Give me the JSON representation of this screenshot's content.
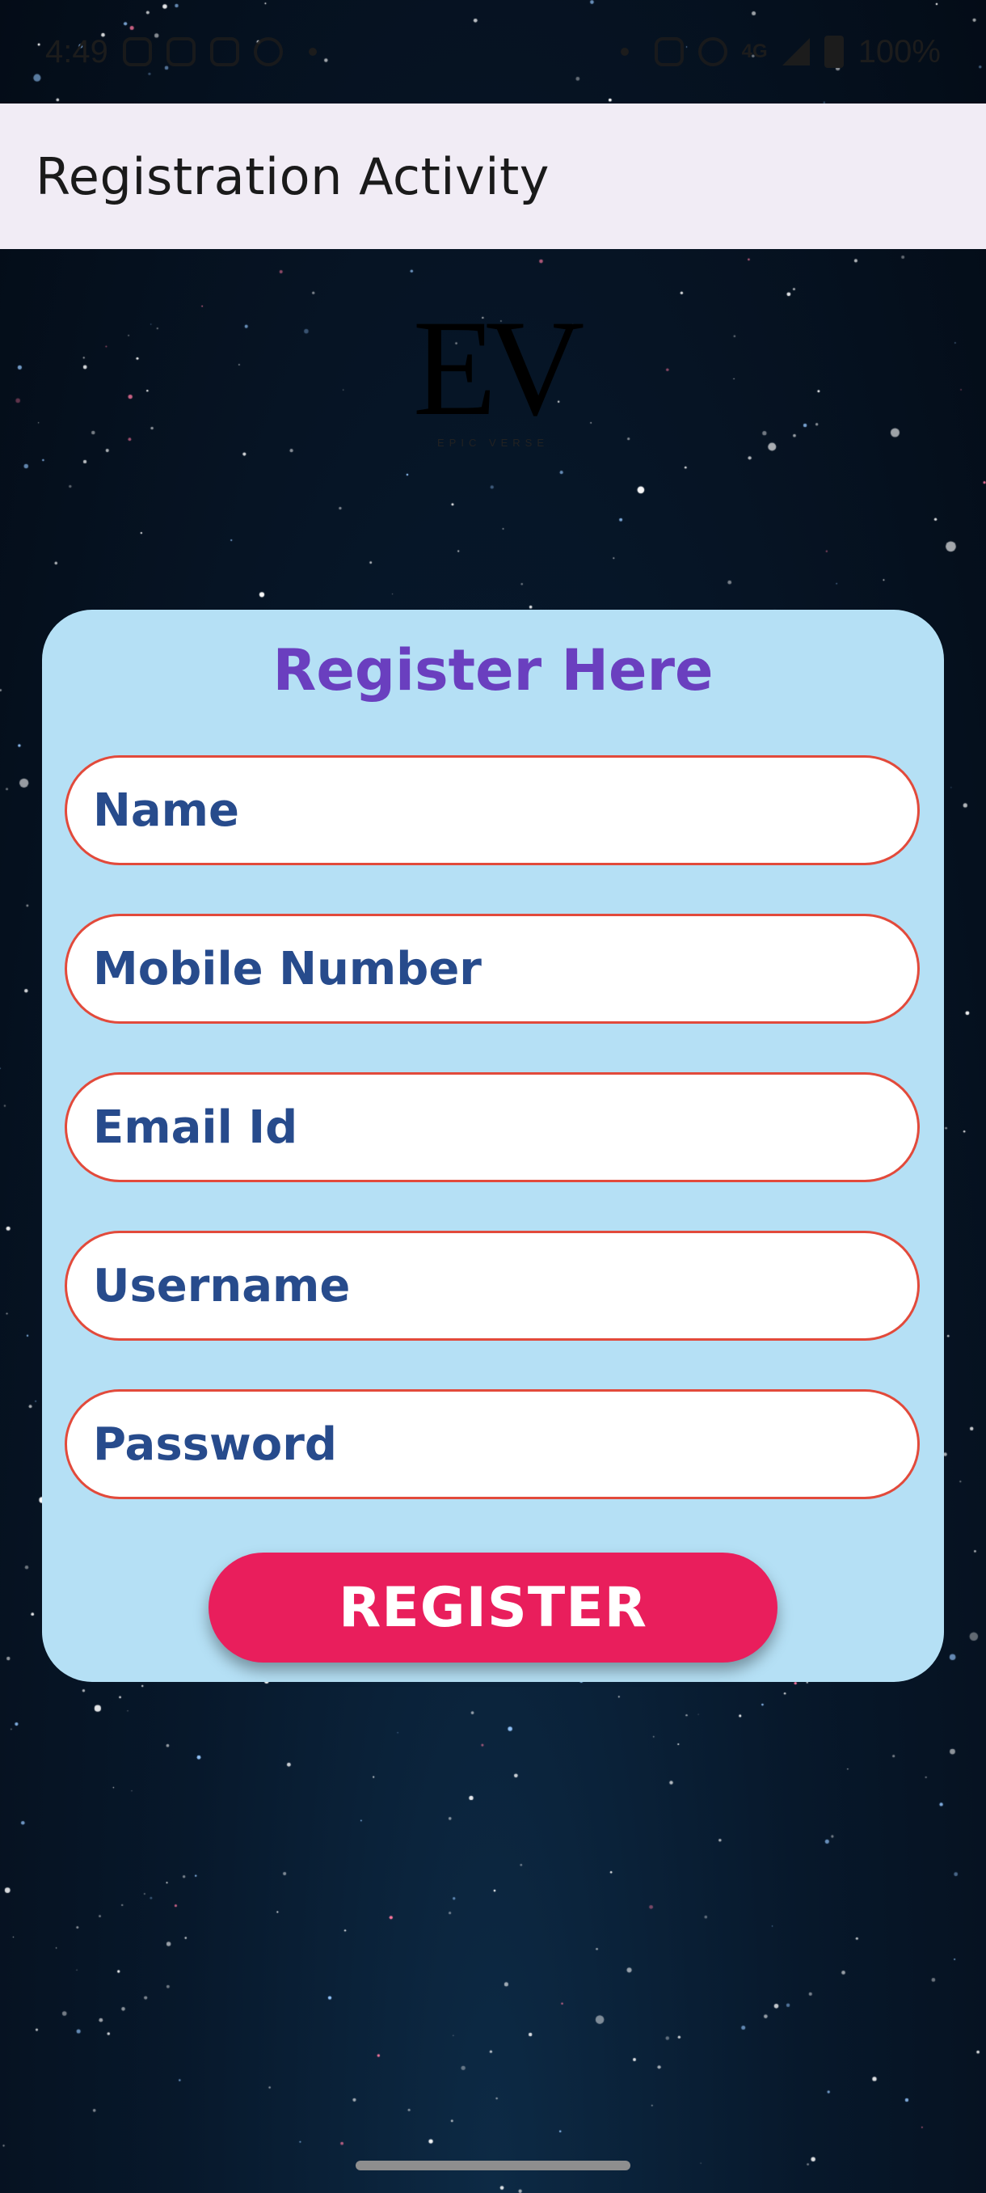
{
  "status_bar": {
    "time": "4:49",
    "network": "4G",
    "battery": "100%"
  },
  "app_bar": {
    "title": "Registration Activity"
  },
  "logo": {
    "mark": "EV",
    "subtitle": "EPIC VERSE"
  },
  "form": {
    "title": "Register Here",
    "fields": [
      {
        "placeholder": "Name"
      },
      {
        "placeholder": "Mobile Number"
      },
      {
        "placeholder": "Email Id"
      },
      {
        "placeholder": "Username"
      },
      {
        "placeholder": "Password"
      }
    ],
    "submit_label": "REGISTER"
  },
  "colors": {
    "app_bar_bg": "#f1ecf5",
    "card_bg": "#b5e0f5",
    "title_color": "#6a3fbf",
    "field_border": "#e24a3b",
    "field_text": "#274b8c",
    "button_bg": "#e91e5c"
  }
}
